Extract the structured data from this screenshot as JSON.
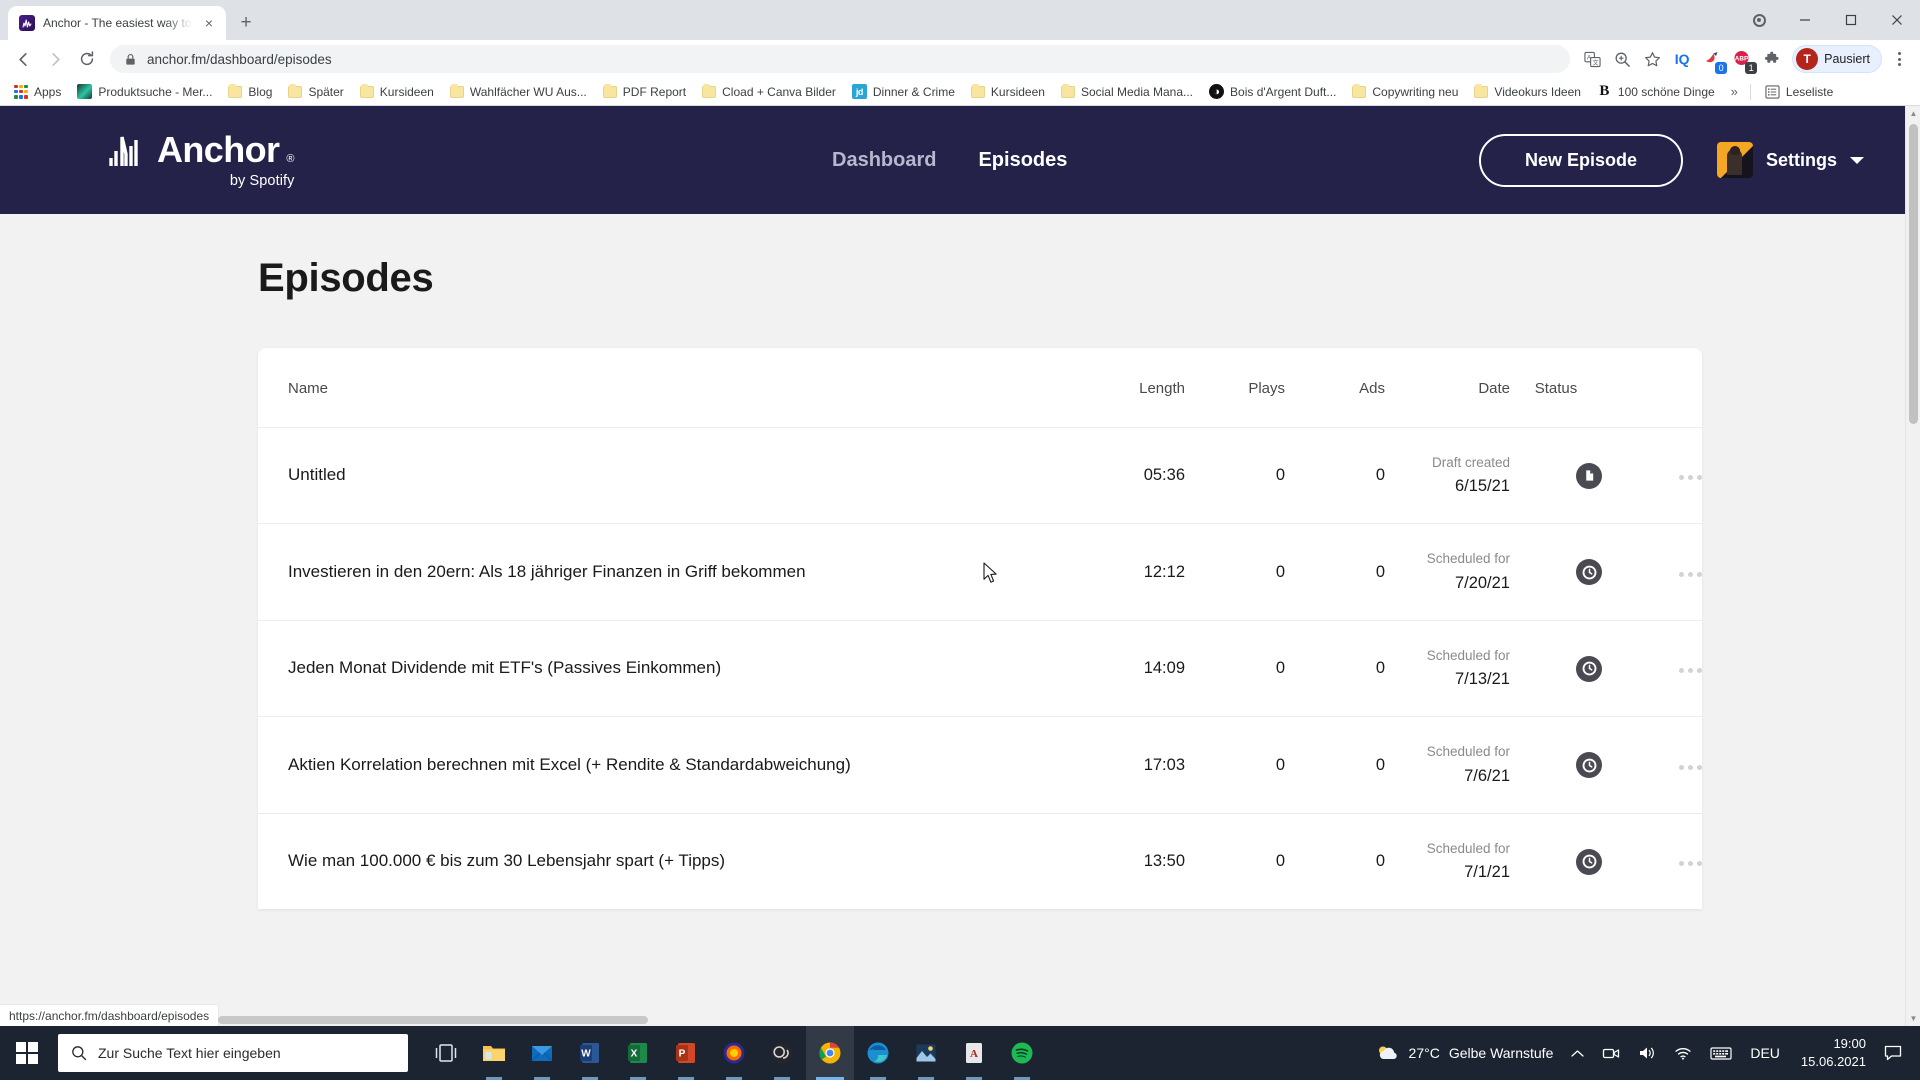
{
  "browser": {
    "tab": {
      "title": "Anchor - The easiest way to mak",
      "favicon": "anchor-favicon",
      "close": "×"
    },
    "new_tab": "+",
    "window_controls": {
      "record": "record-dot",
      "minimize": "—",
      "maximize": "☐",
      "close": "✕"
    },
    "nav": {
      "back": "←",
      "forward": "→",
      "reload": "↻"
    },
    "omnibox": {
      "lock": "lock-icon",
      "url": "anchor.fm/dashboard/episodes"
    },
    "toolbar_icons": [
      {
        "name": "translate-icon",
        "glyph": "translate"
      },
      {
        "name": "zoom-icon",
        "glyph": "zoom"
      },
      {
        "name": "bookmark-star-icon",
        "glyph": "☆"
      },
      {
        "name": "iq-extension-icon",
        "glyph": "IQ"
      },
      {
        "name": "bird-extension-icon",
        "glyph": "bird",
        "badge": "0"
      },
      {
        "name": "adblock-extension-icon",
        "glyph": "ABP",
        "badge": "1"
      },
      {
        "name": "extensions-puzzle-icon",
        "glyph": "puzzle"
      }
    ],
    "profile": {
      "initial": "T",
      "label": "Pausiert"
    },
    "bookmarks": [
      {
        "label": "Apps",
        "icon": "apps-grid-icon"
      },
      {
        "label": "Produktsuche - Mer...",
        "icon": "merch-favicon"
      },
      {
        "label": "Blog",
        "icon": "folder-icon"
      },
      {
        "label": "Später",
        "icon": "folder-icon"
      },
      {
        "label": "Kursideen",
        "icon": "folder-icon"
      },
      {
        "label": "Wahlfächer WU Aus...",
        "icon": "folder-icon"
      },
      {
        "label": "PDF Report",
        "icon": "folder-icon"
      },
      {
        "label": "Cload + Canva Bilder",
        "icon": "folder-icon"
      },
      {
        "label": "Dinner & Crime",
        "icon": "jd-favicon"
      },
      {
        "label": "Kursideen",
        "icon": "folder-icon"
      },
      {
        "label": "Social Media Mana...",
        "icon": "folder-icon"
      },
      {
        "label": "Bois d'Argent Duft...",
        "icon": "bois-favicon"
      },
      {
        "label": "Copywriting neu",
        "icon": "folder-icon"
      },
      {
        "label": "Videokurs Ideen",
        "icon": "folder-icon"
      },
      {
        "label": "100 schöne Dinge",
        "icon": "b-favicon"
      }
    ],
    "bookmarks_overflow": "»",
    "reading_list": "Leseliste",
    "status_link": "https://anchor.fm/dashboard/episodes"
  },
  "site": {
    "logo": {
      "text": "Anchor",
      "registered": "®",
      "subtitle": "by Spotify"
    },
    "nav": [
      {
        "label": "Dashboard",
        "active": false
      },
      {
        "label": "Episodes",
        "active": true
      }
    ],
    "new_episode_button": "New Episode",
    "settings": {
      "label": "Settings",
      "caret": "chevron-down-icon",
      "avatar": "user-avatar"
    },
    "page_title": "Episodes",
    "table": {
      "columns": [
        "Name",
        "Length",
        "Plays",
        "Ads",
        "Date",
        "Status"
      ],
      "rows": [
        {
          "name": "Untitled",
          "length": "05:36",
          "plays": "0",
          "ads": "0",
          "date_label": "Draft created",
          "date": "6/15/21",
          "status_icon": "draft-document-icon"
        },
        {
          "name": "Investieren in den 20ern: Als 18 jähriger Finanzen in Griff bekommen",
          "length": "12:12",
          "plays": "0",
          "ads": "0",
          "date_label": "Scheduled for",
          "date": "7/20/21",
          "status_icon": "scheduled-clock-icon"
        },
        {
          "name": "Jeden Monat Dividende mit ETF's (Passives Einkommen)",
          "length": "14:09",
          "plays": "0",
          "ads": "0",
          "date_label": "Scheduled for",
          "date": "7/13/21",
          "status_icon": "scheduled-clock-icon"
        },
        {
          "name": "Aktien Korrelation berechnen mit Excel (+ Rendite & Standardabweichung)",
          "length": "17:03",
          "plays": "0",
          "ads": "0",
          "date_label": "Scheduled for",
          "date": "7/6/21",
          "status_icon": "scheduled-clock-icon"
        },
        {
          "name": "Wie man 100.000 € bis zum 30 Lebensjahr spart (+ Tipps)",
          "length": "13:50",
          "plays": "0",
          "ads": "0",
          "date_label": "Scheduled for",
          "date": "7/1/21",
          "status_icon": "scheduled-clock-icon"
        }
      ]
    }
  },
  "taskbar": {
    "start": "windows-start-icon",
    "search_placeholder": "Zur Suche Text hier eingeben",
    "apps": [
      {
        "name": "task-view-icon"
      },
      {
        "name": "file-explorer-icon"
      },
      {
        "name": "mail-icon"
      },
      {
        "name": "word-icon"
      },
      {
        "name": "excel-icon"
      },
      {
        "name": "powerpoint-icon"
      },
      {
        "name": "firefox-icon"
      },
      {
        "name": "obs-icon"
      },
      {
        "name": "chrome-icon"
      },
      {
        "name": "edge-icon"
      },
      {
        "name": "photos-icon"
      },
      {
        "name": "acrobat-icon"
      },
      {
        "name": "spotify-icon"
      }
    ],
    "tray": {
      "weather_temp": "27°C",
      "weather_text": "Gelbe Warnstufe",
      "chevron": "˄",
      "time": "19:00",
      "date": "15.06.2021"
    }
  },
  "colors": {
    "anchor_header": "#25224a",
    "page_bg": "#f2f2f2",
    "card_bg": "#ffffff",
    "taskbar": "#1b2430",
    "profile_chip": "#e8f0fe",
    "status_icon": "#4a4a52"
  }
}
